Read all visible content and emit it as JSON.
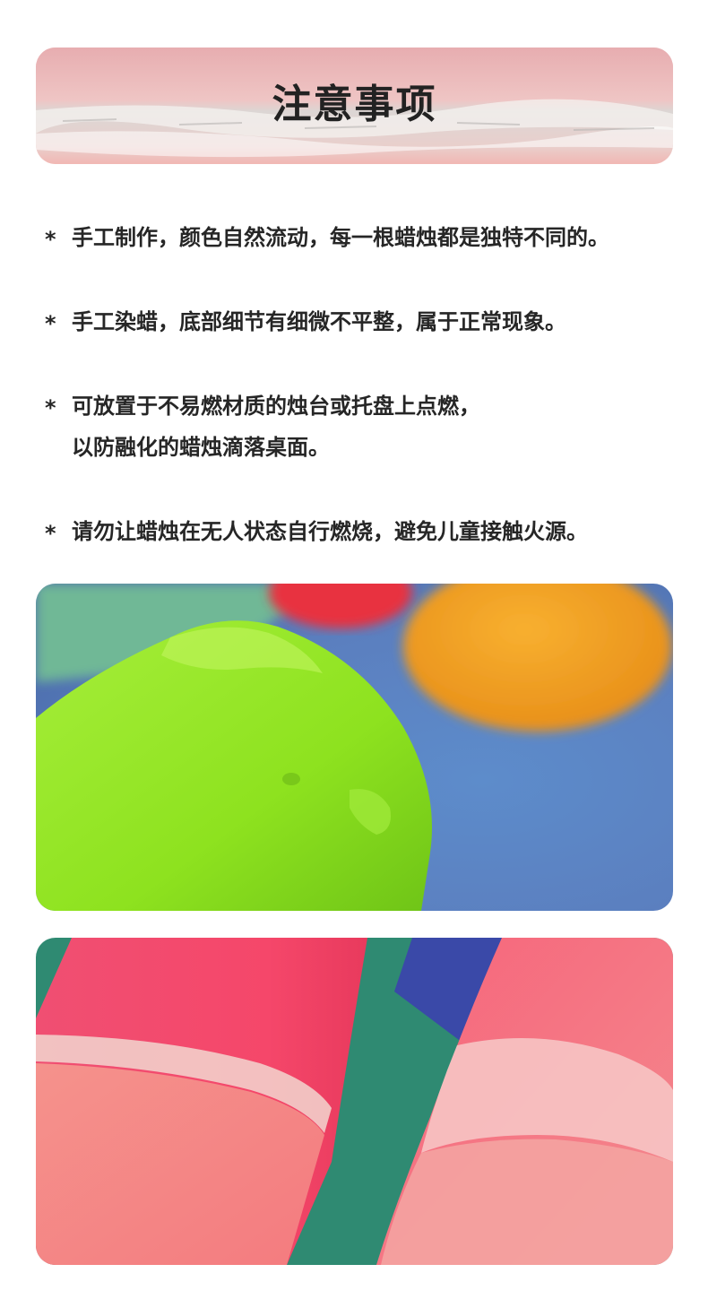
{
  "header": {
    "title": "注意事项"
  },
  "notes": [
    {
      "marker": "*",
      "lines": [
        "手工制作，颜色自然流动，每一根蜡烛都是独特不同的。"
      ]
    },
    {
      "marker": "*",
      "lines": [
        "手工染蜡，底部细节有细微不平整，属于正常现象。"
      ]
    },
    {
      "marker": "*",
      "lines": [
        "可放置于不易燃材质的烛台或托盘上点燃，",
        "以防融化的蜡烛滴落桌面。"
      ]
    },
    {
      "marker": "*",
      "lines": [
        "请勿让蜡烛在无人状态自行燃烧，避免儿童接触火源。"
      ]
    }
  ],
  "images": [
    {
      "name": "green-candle-photo",
      "colors": [
        "#8ee21f",
        "#f0a020",
        "#e83040",
        "#5a86c8",
        "#6fb896"
      ]
    },
    {
      "name": "pink-candles-photo",
      "colors": [
        "#f5476a",
        "#f58b88",
        "#2f8a72",
        "#f7c9c8"
      ]
    }
  ]
}
